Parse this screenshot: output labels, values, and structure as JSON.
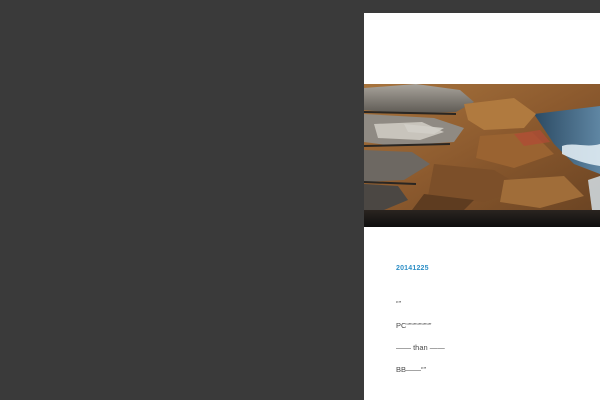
{
  "post": {
    "date": "20141225",
    "lines": [
      "“”",
      "PC“”“”“”“”“”",
      "—— than ——",
      "BB——“”"
    ]
  },
  "colors": {
    "page_background": "#3a3a3a",
    "panel_background": "#ffffff",
    "date_link": "#2e8fc6",
    "body_text": "#4a4a4a"
  },
  "hero_image": {
    "subject": "rocky-coastline-photo"
  }
}
